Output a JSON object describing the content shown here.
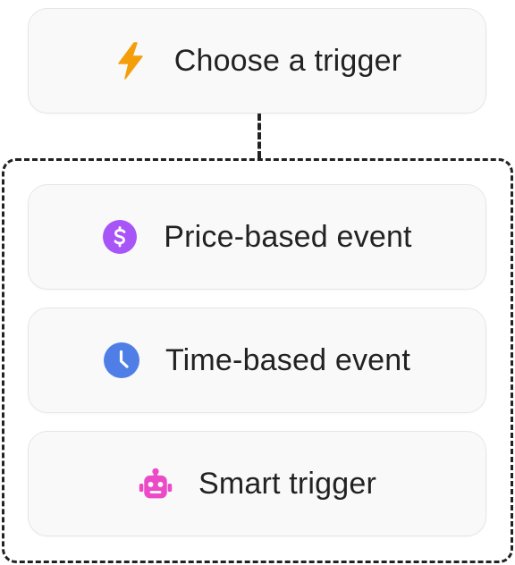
{
  "trigger_card": {
    "label": "Choose a trigger",
    "icon": "lightning-bolt-icon",
    "icon_color": "#F59E0B"
  },
  "options": [
    {
      "label": "Price-based event",
      "icon": "dollar-circle-icon",
      "icon_color": "#A855F7"
    },
    {
      "label": "Time-based event",
      "icon": "clock-icon",
      "icon_color": "#4F7FE6"
    },
    {
      "label": "Smart trigger",
      "icon": "robot-icon",
      "icon_color": "#EC4BC7"
    }
  ]
}
